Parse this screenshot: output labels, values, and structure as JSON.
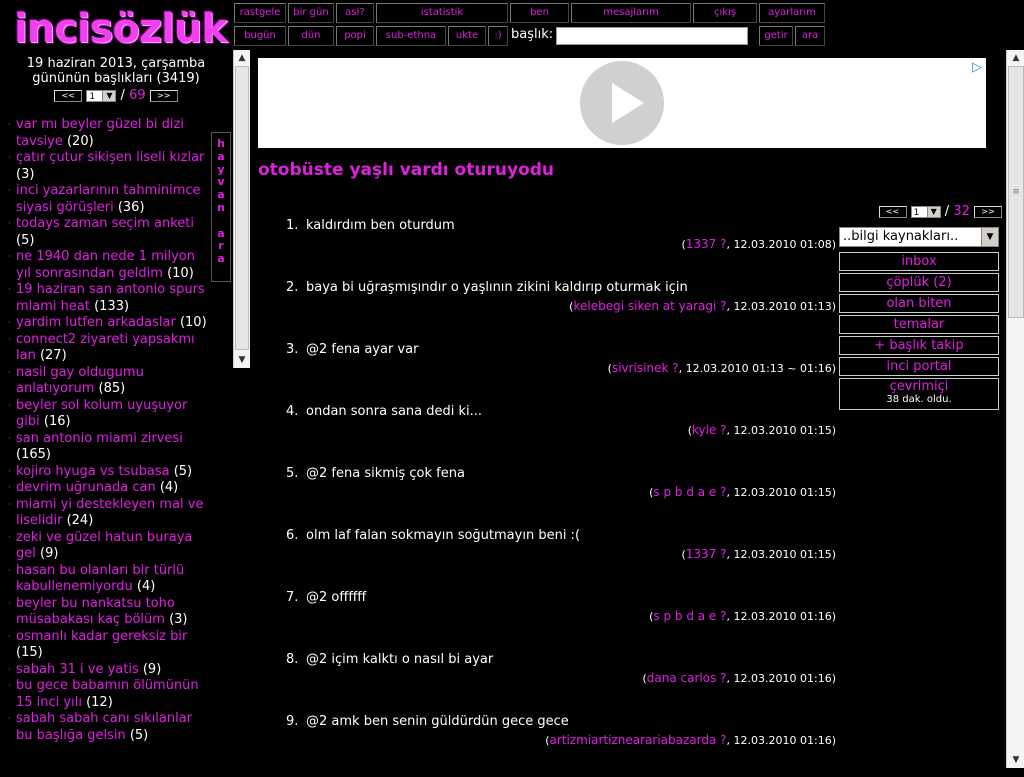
{
  "logo": {
    "text": "incisözlük"
  },
  "nav": {
    "row1": [
      "rastgele",
      "bir gün",
      "asl?",
      "istatistik",
      "ben",
      "mesajlarım",
      "çıkış",
      "ayarlarım"
    ],
    "row2": [
      "bugün",
      "dün",
      "popi",
      "sub-ethna",
      "ukte",
      ":)"
    ],
    "baslik_label": "başlık:",
    "baslik_value": "",
    "getir": "getir",
    "ara": "ara"
  },
  "left": {
    "date_line1": "19 haziran 2013, çarşamba",
    "date_line2": "gününün başlıkları (3419)",
    "prev": "<<",
    "page_value": "1",
    "page_sep": "/",
    "page_total": "69",
    "next": ">>",
    "hayvan_ara": "hayvan ara",
    "topics": [
      {
        "title": "var mı beyler güzel bi dizi tavsiye",
        "count": "(20)"
      },
      {
        "title": "çatır çutur sikişen liseli kızlar",
        "count": "(3)"
      },
      {
        "title": "inci yazarlarının tahminimce siyasi görüşleri",
        "count": "(36)"
      },
      {
        "title": "todays zaman seçim anketi",
        "count": "(5)"
      },
      {
        "title": "ne 1940 dan nede 1 milyon yıl sonrasından geldim",
        "count": "(10)"
      },
      {
        "title": "19 haziran san antonio spurs miami heat",
        "count": "(133)"
      },
      {
        "title": "yardim lutfen arkadaslar",
        "count": "(10)"
      },
      {
        "title": "connect2 ziyareti yapsakmı lan",
        "count": "(27)"
      },
      {
        "title": "nasil gay oldugumu anlatıyorum",
        "count": "(85)"
      },
      {
        "title": "beyler sol kolum uyuşuyor gibi",
        "count": "(16)"
      },
      {
        "title": "san antonio miami zirvesi",
        "count": "(165)"
      },
      {
        "title": "kojiro hyuga vs tsubasa",
        "count": "(5)"
      },
      {
        "title": "devrim uğrunada can",
        "count": "(4)"
      },
      {
        "title": "miami yi destekleyen mal ve liselidir",
        "count": "(24)"
      },
      {
        "title": "zeki ve güzel hatun buraya gel",
        "count": "(9)"
      },
      {
        "title": "hasan bu olanları bir türlü kabullenemiyordu",
        "count": "(4)"
      },
      {
        "title": "beyler bu nankatsu toho müsabakası kaç bölüm",
        "count": "(3)"
      },
      {
        "title": "osmanlı kadar gereksiz bir",
        "count": "(15)"
      },
      {
        "title": "sabah 31 i ve yatis",
        "count": "(9)"
      },
      {
        "title": "bu gece babamın ölümünün 15 inci yılı",
        "count": "(12)"
      },
      {
        "title": "sabah sabah canı sıkılanlar bu başlığa gelsin",
        "count": "(5)"
      }
    ]
  },
  "main": {
    "title": "otobüste yaşlı vardı oturuyodu",
    "prev": "<<",
    "page_value": "1",
    "page_sep": "/",
    "page_total": "32",
    "next": ">>",
    "sources_select": "..bilgi kaynakları..",
    "menu": [
      "inbox",
      "çöplük (2)",
      "olan biten",
      "temalar",
      "+ başlık takip",
      "inci portal"
    ],
    "online_label": "çevrimiçi",
    "online_sub": "38 dak. oldu.",
    "entries": [
      {
        "num": "1.",
        "text": "kaldırdım ben oturdum",
        "author": "1337 ?",
        "date": "12.03.2010 01:08"
      },
      {
        "num": "2.",
        "text": "baya bi uğraşmışındır o yaşlının zikini kaldırıp oturmak için",
        "author": "kelebegi siken at yaragi ?",
        "date": "12.03.2010 01:13"
      },
      {
        "num": "3.",
        "text": "@2 fena ayar var",
        "author": "sivrisinek ?",
        "date": "12.03.2010 01:13 ~ 01:16"
      },
      {
        "num": "4.",
        "text": "ondan sonra sana dedi ki...",
        "author": "kyle ?",
        "date": "12.03.2010 01:15"
      },
      {
        "num": "5.",
        "text": "@2 fena sikmiş çok fena",
        "author": "s p b d a e ?",
        "date": "12.03.2010 01:15"
      },
      {
        "num": "6.",
        "text": "olm laf falan sokmayın soğutmayın beni :(",
        "author": "1337 ?",
        "date": "12.03.2010 01:15"
      },
      {
        "num": "7.",
        "text": "@2 offffff",
        "author": "s p b d a e ?",
        "date": "12.03.2010 01:16"
      },
      {
        "num": "8.",
        "text": "@2 içim kalktı o nasıl bi ayar",
        "author": "dana carlos ?",
        "date": "12.03.2010 01:16"
      },
      {
        "num": "9.",
        "text": "@2 amk ben senin güldürdün gece gece",
        "author": "artizmiartiznearariabazarda ?",
        "date": "12.03.2010 01:16"
      }
    ]
  },
  "colors": {
    "accent": "#e020e0",
    "background": "#000000",
    "text": "#ffffff"
  }
}
